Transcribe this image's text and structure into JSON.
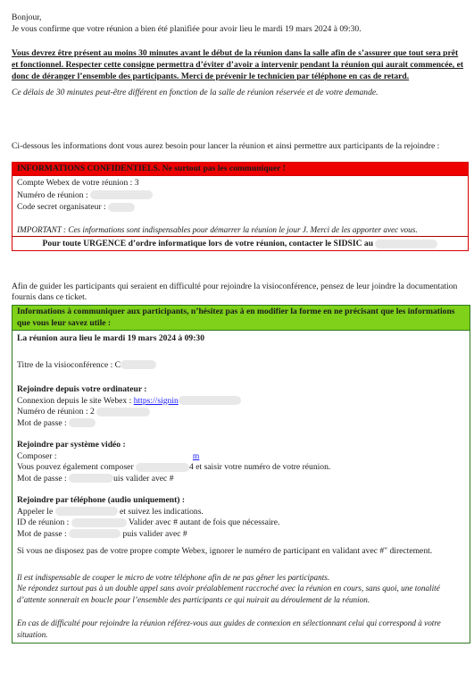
{
  "intro": {
    "greeting": "Bonjour,",
    "line": "Je vous confirme que votre réunion a bien été planifiée pour avoir lieu le mardi 19 mars 2024 à 09:30.",
    "warning": "Vous devrez être présent au moins 30 minutes avant le début de la réunion dans la salle afin de s’assurer que tout sera prêt et fonctionnel. Respecter cette consigne permettra d’éviter d’avoir a intervenir pendant la réunion qui aurait commencée, et donc de déranger l’ensemble des participants. Merci de prévenir le technicien par téléphone en cas de retard.",
    "note": "Ce délais de 30 minutes peut-être différent en fonction de la salle de réunion réservée et de votre demande.",
    "info_line": "Ci-dessous les informations dont vous aurez besoin pour lancer la réunion et ainsi permettre aux participants de la rejoindre :"
  },
  "confidential": {
    "header": "INFORMATIONS CONFIDENTIELS. Ne surtout pas les communiquer !",
    "account": "Compte Webex de votre réunion : 3",
    "meeting_number": "Numéro de réunion :",
    "host_code": "Code secret organisateur :",
    "important": "IMPORTANT : Ces informations sont indispensables pour démarrer la réunion le jour J. Merci de les apporter avec vous.",
    "urgent": "Pour toute URGENCE d’ordre informatique lors de votre réunion, contacter le SIDSIC au"
  },
  "guide_text": "Afin de guider les participants qui seraient en difficulté pour rejoindre la visioconférence, pensez de leur joindre la documentation fournis dans ce ticket.",
  "participants": {
    "header": "Informations à communiquer aux participants, n’hésitez pas à en modifier la forme en ne précisant que les informations que vous leur savez utile :",
    "date_line": "La réunion aura lieu le mardi 19 mars 2024 à 09:30",
    "title_label": "Titre de la visioconférence : C",
    "computer_title": "Rejoindre depuis votre ordinateur :",
    "computer_link_label": "Connexion depuis le site Webex :",
    "computer_link": "https://signin",
    "computer_meeting_number": "Numéro de réunion : 2",
    "computer_password": "Mot de passe :",
    "video_title": "Rejoindre par système vidéo :",
    "video_dial": "Composer :",
    "video_dial_end": "m",
    "video_alt_1": "Vous pouvez également composer",
    "video_alt_2": "4 et saisir votre numéro de votre réunion.",
    "video_password_1": "Mot de passe :",
    "video_password_2": "uis valider avec #",
    "phone_title": "Rejoindre par téléphone (audio uniquement) :",
    "phone_call_1": "Appeler le",
    "phone_call_2": "et suivez les indications.",
    "phone_id_1": "ID de réunion :",
    "phone_id_2": "Valider avec # autant de fois que nécessaire.",
    "phone_password_1": "Mot de passe :",
    "phone_password_2": "puis valider avec #",
    "no_account": "Si vous ne disposez pas de votre propre compte Webex, ignorer le numéro de participant en validant avec #\" directement.",
    "mute_1": "Il est indispensable de couper le micro de votre téléphone afin de ne pas gêner les participants.",
    "mute_2": "Ne répondez surtout pas à un double appel sans avoir préalablement raccroché avec la réunion en cours, sans quoi, une tonalité d’attente sonnerait en boucle pour l’ensemble des participants ce qui nuirait au déroulement de la réunion.",
    "help": "En cas de difficulté pour rejoindre la réunion référez-vous aux guides de connexion en sélectionnant celui qui correspond à votre situation."
  }
}
